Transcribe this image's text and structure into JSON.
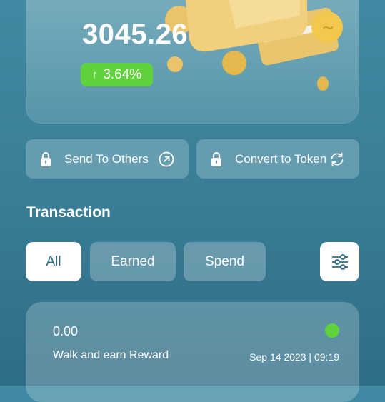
{
  "balance": {
    "amount": "3045.26",
    "change": "3.64%",
    "change_direction_icon": "arrow-up-icon"
  },
  "actions": {
    "send_label": "Send To Others",
    "convert_label": "Convert to Token"
  },
  "transactions": {
    "title": "Transaction",
    "tabs": [
      "All",
      "Earned",
      "Spend"
    ],
    "active_tab": "All",
    "items": [
      {
        "amount": "0.00",
        "title": "Walk and earn Reward",
        "time": "Sep 14 2023 | 09:19",
        "status_color": "#5fd23b"
      }
    ]
  },
  "colors": {
    "accent_green": "#5fd23b",
    "background": "#3a7f98"
  }
}
